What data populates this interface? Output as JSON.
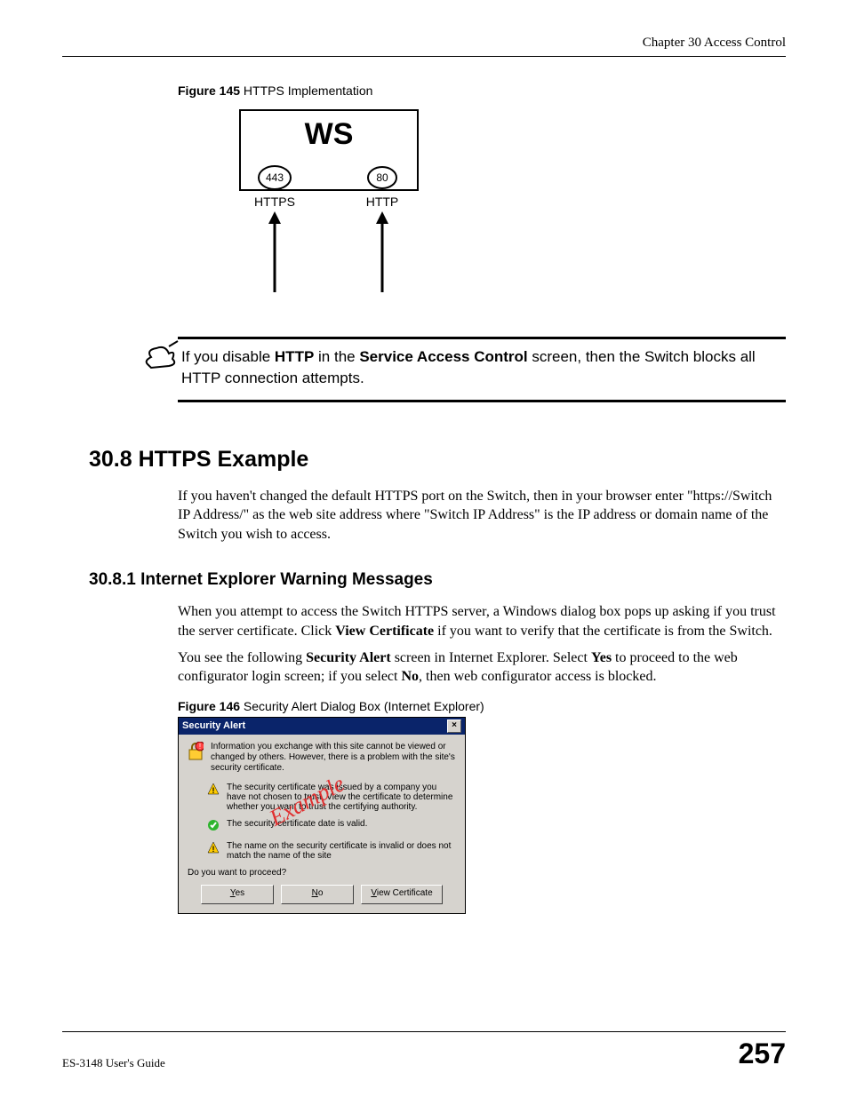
{
  "header": {
    "chapter": "Chapter 30 Access Control"
  },
  "figure145": {
    "caption_bold": "Figure 145",
    "caption_rest": "   HTTPS Implementation",
    "ws": "WS",
    "port443": "443",
    "port80": "80",
    "https": "HTTPS",
    "http": "HTTP"
  },
  "note": {
    "pre": "If you disable ",
    "http": "HTTP",
    "mid": " in the ",
    "sac": "Service Access Control",
    "post": " screen, then the Switch blocks all HTTP connection attempts."
  },
  "section308": {
    "heading": "30.8  HTTPS Example",
    "para": "If you haven't changed the default HTTPS port on the Switch, then in your browser enter \"https://Switch IP Address/\" as the web site address where \"Switch IP Address\" is the IP address or domain name of the Switch you wish to access."
  },
  "section3081": {
    "heading": "30.8.1  Internet Explorer Warning Messages",
    "para1_pre": "When you attempt to access the Switch HTTPS server, a Windows dialog box pops up asking if you trust the server certificate. Click ",
    "para1_bold": "View Certificate",
    "para1_post": " if you want to verify that the certificate is from the Switch.",
    "para2_pre": "You see the following ",
    "para2_b1": "Security Alert",
    "para2_mid1": " screen in Internet Explorer. Select ",
    "para2_b2": "Yes",
    "para2_mid2": " to proceed to the web configurator login screen; if you select ",
    "para2_b3": "No",
    "para2_post": ", then web configurator access is blocked."
  },
  "figure146": {
    "caption_bold": "Figure 146",
    "caption_rest": "   Security Alert Dialog Box (Internet Explorer)"
  },
  "dialog": {
    "title": "Security Alert",
    "close": "×",
    "intro": "Information you exchange with this site cannot be viewed or changed by others. However, there is a problem with the site's security certificate.",
    "item1": "The security certificate was issued by a company you have not chosen to trust. View the certificate to determine whether you want to trust the certifying authority.",
    "item2": "The security certificate date is valid.",
    "item3": "The name on the security certificate is invalid or does not match the name of the site",
    "proceed": "Do you want to proceed?",
    "yes_u": "Y",
    "yes_rest": "es",
    "no_u": "N",
    "no_rest": "o",
    "view_u": "V",
    "view_rest": "iew Certificate"
  },
  "stamp": "Example",
  "footer": {
    "guide": "ES-3148 User's Guide",
    "pagenum": "257"
  }
}
